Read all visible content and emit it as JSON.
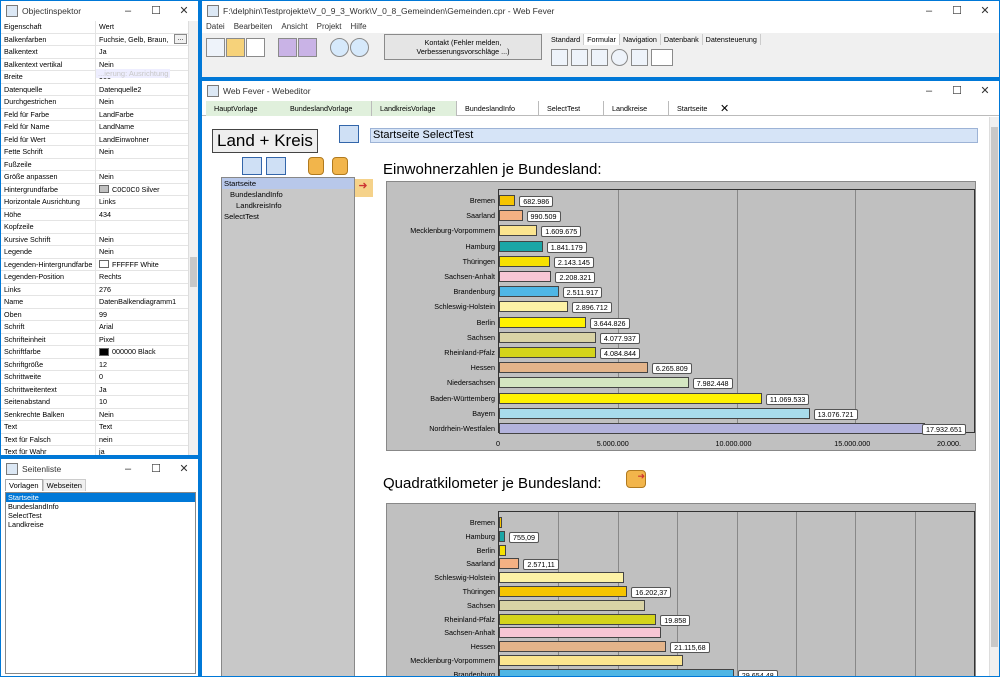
{
  "inspector": {
    "title": "Objectinspektor",
    "head_prop": "Eigenschaft",
    "head_val": "Wert",
    "ghost": "...ierung: Ausrichtung",
    "rows": [
      {
        "p": "Balkenfarben",
        "v": "Fuchsie, Gelb, Braun,"
      },
      {
        "p": "Balkentext",
        "v": "Ja"
      },
      {
        "p": "Balkentext vertikal",
        "v": "Nein"
      },
      {
        "p": "Breite",
        "v": "900"
      },
      {
        "p": "Datenquelle",
        "v": "Datenquelle2"
      },
      {
        "p": "Durchgestrichen",
        "v": "Nein"
      },
      {
        "p": "Feld für Farbe",
        "v": "LandFarbe"
      },
      {
        "p": "Feld für Name",
        "v": "LandName"
      },
      {
        "p": "Feld für Wert",
        "v": "LandEinwohner"
      },
      {
        "p": "Fette Schrift",
        "v": "Nein"
      },
      {
        "p": "Fußzeile",
        "v": ""
      },
      {
        "p": "Größe anpassen",
        "v": "Nein"
      },
      {
        "p": "Hintergrundfarbe",
        "v": "C0C0C0 Silver"
      },
      {
        "p": "Horizontale Ausrichtung",
        "v": "Links"
      },
      {
        "p": "Höhe",
        "v": "434"
      },
      {
        "p": "Kopfzeile",
        "v": ""
      },
      {
        "p": "Kursive Schrift",
        "v": "Nein"
      },
      {
        "p": "Legende",
        "v": "Nein"
      },
      {
        "p": "Legenden-Hintergrundfarbe",
        "v": "FFFFFF White"
      },
      {
        "p": "Legenden-Position",
        "v": "Rechts"
      },
      {
        "p": "Links",
        "v": "276"
      },
      {
        "p": "Name",
        "v": "DatenBalkendiagramm1"
      },
      {
        "p": "Oben",
        "v": "99"
      },
      {
        "p": "Schrift",
        "v": "Arial"
      },
      {
        "p": "Schrifteinheit",
        "v": "Pixel"
      },
      {
        "p": "Schriftfarbe",
        "v": "000000 Black"
      },
      {
        "p": "Schriftgröße",
        "v": "12"
      },
      {
        "p": "Schrittweite",
        "v": "0"
      },
      {
        "p": "Schrittweitentext",
        "v": "Ja"
      },
      {
        "p": "Seitenabstand",
        "v": "10"
      },
      {
        "p": "Senkrechte Balken",
        "v": "Nein"
      },
      {
        "p": "Text",
        "v": "Text"
      },
      {
        "p": "Text für Falsch",
        "v": "nein"
      },
      {
        "p": "Text für Wahr",
        "v": "ja"
      }
    ],
    "swatch_colors": {
      "Hintergrundfarbe": "#c0c0c0",
      "Legenden-Hintergrundfarbe": "#ffffff",
      "Schriftfarbe": "#000000"
    }
  },
  "seitenliste": {
    "title": "Seitenliste",
    "tabs": [
      "Vorlagen",
      "Webseiten"
    ],
    "items": [
      "Startseite",
      "BundeslandInfo",
      "SelectTest",
      "Landkreise"
    ]
  },
  "app": {
    "title": "F:\\delphin\\Testprojekte\\V_0_9_3_Work\\V_0_8_Gemeinden\\Gemeinden.cpr - Web Fever",
    "menu": [
      "Datei",
      "Bearbeiten",
      "Ansicht",
      "Projekt",
      "Hilfe"
    ],
    "contact_button": "Kontakt (Fehler melden, Verbesserungsvorschläge ...)",
    "palette_tabs": [
      "Standard",
      "Formular",
      "Navigation",
      "Datenbank",
      "Datensteuerung"
    ]
  },
  "editor": {
    "title": "Web Fever - Webeditor",
    "page_tabs": [
      "HauptVorlage",
      "BundeslandVorlage",
      "LandkreisVorlage",
      "BundeslandInfo",
      "SelectTest",
      "Landkreise",
      "Startseite"
    ],
    "logo": "Land + Kreis",
    "breadcrumb": "Startseite SelectTest",
    "nav_tree": [
      "Startseite",
      "BundeslandInfo",
      "LandkreisInfo",
      "SelectTest"
    ]
  },
  "chart_data": [
    {
      "type": "bar",
      "title": "Einwohnerzahlen je Bundesland:",
      "categories": [
        "Bremen",
        "Saarland",
        "Mecklenburg-Vorpommern",
        "Hamburg",
        "Thüringen",
        "Sachsen-Anhalt",
        "Brandenburg",
        "Schleswig-Holstein",
        "Berlin",
        "Sachsen",
        "Rheinland-Pfalz",
        "Hessen",
        "Niedersachsen",
        "Baden-Württemberg",
        "Bayern",
        "Nordrhein-Westfalen"
      ],
      "values": [
        682986,
        990509,
        1609675,
        1841179,
        2143145,
        2208321,
        2511917,
        2896712,
        3644826,
        4077937,
        4084844,
        6265809,
        7982448,
        11069533,
        13076721,
        17932651
      ],
      "labels": [
        "682.986",
        "990.509",
        "1.609.675",
        "1.841.179",
        "2.143.145",
        "2.208.321",
        "2.511.917",
        "2.896.712",
        "3.644.826",
        "4.077.937",
        "4.084.844",
        "6.265.809",
        "7.982.448",
        "11.069.533",
        "13.076.721",
        "17.932.651"
      ],
      "colors": [
        "#f5c400",
        "#f4b183",
        "#fbe58f",
        "#1aa6a6",
        "#f6e000",
        "#f7c6d4",
        "#4fb6e5",
        "#fdf2a6",
        "#fff200",
        "#d9d3a6",
        "#d4d41a",
        "#e3b48a",
        "#d4e6c1",
        "#fff200",
        "#a8dcec",
        "#b3b3dc"
      ],
      "xticks": [
        "0",
        "5.000.000",
        "10.000.000",
        "15.000.000",
        "20.000."
      ],
      "xlim": [
        0,
        20000000
      ],
      "grid": true
    },
    {
      "type": "bar",
      "title": "Quadratkilometer je Bundesland:",
      "categories": [
        "Bremen",
        "Hamburg",
        "Berlin",
        "Saarland",
        "Schleswig-Holstein",
        "Thüringen",
        "Sachsen",
        "Rheinland-Pfalz",
        "Sachsen-Anhalt",
        "Hessen",
        "Mecklenburg-Vorpommern",
        "Brandenburg"
      ],
      "values": [
        419,
        755.09,
        891,
        2571.11,
        15804,
        16202.37,
        18450,
        19858,
        20452,
        21115.68,
        23295,
        29654.48
      ],
      "labels": [
        "",
        "755,09",
        "",
        "2.571,11",
        "",
        "16.202,37",
        "",
        "19.858",
        "",
        "21.115,68",
        "",
        "29.654,48"
      ],
      "colors": [
        "#f5c400",
        "#1aa6a6",
        "#f6e000",
        "#f4b183",
        "#fdf2a6",
        "#f5c400",
        "#d9d3a6",
        "#d4d41a",
        "#f7c6d4",
        "#e3b48a",
        "#fbe58f",
        "#4fb6e5"
      ],
      "xlim": [
        0,
        60000
      ],
      "grid": true
    }
  ]
}
